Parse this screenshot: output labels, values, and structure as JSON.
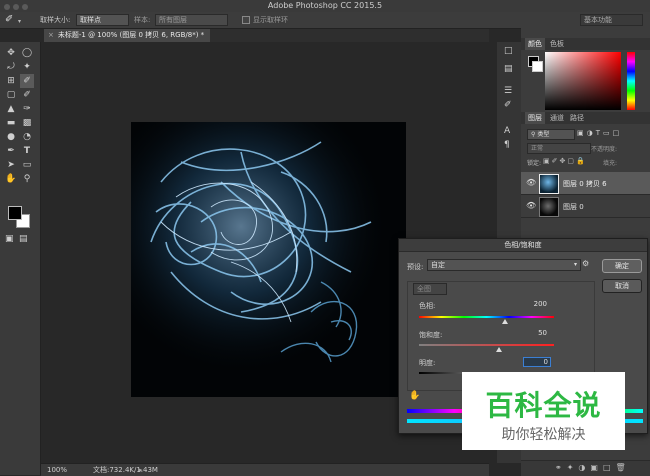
{
  "window": {
    "title": "Adobe Photoshop CC 2015.5"
  },
  "options": {
    "sample_size_label": "取样大小:",
    "sample_size_value": "取样点",
    "sample_label": "样本:",
    "sample_value": "所有图层",
    "show_ring_label": "显示取样环",
    "workspace": "基本功能"
  },
  "document": {
    "tab": "未标题-1 @ 100% (图层 0 拷贝 6, RGB/8*) *",
    "zoom": "100%",
    "doc_size": "文档:732.4K/1.43M"
  },
  "panels": {
    "color_tabs": [
      "颜色",
      "色板"
    ],
    "layer_tabs": [
      "图层",
      "通道",
      "路径"
    ],
    "filter_kind": "类型",
    "blend_mode": "正常",
    "opacity_label": "不透明度:",
    "lock_label": "锁定:",
    "fill_label": "填充:",
    "layers": [
      {
        "name": "图层 0 拷贝 6",
        "selected": true
      },
      {
        "name": "图层 0",
        "selected": false
      }
    ]
  },
  "dialog": {
    "title": "色相/饱和度",
    "preset_label": "预设:",
    "preset_value": "自定",
    "channel_value": "全图",
    "ok": "确定",
    "cancel": "取消",
    "hue_label": "色相:",
    "hue_value": "200",
    "saturation_label": "饱和度:",
    "saturation_value": "50",
    "lightness_label": "明度:",
    "lightness_value": "0"
  },
  "watermark": {
    "title": "百科全说",
    "subtitle": "助你轻松解决"
  },
  "colors": {
    "accent": "#1e90ff",
    "watermark_red": "#c8151d"
  }
}
